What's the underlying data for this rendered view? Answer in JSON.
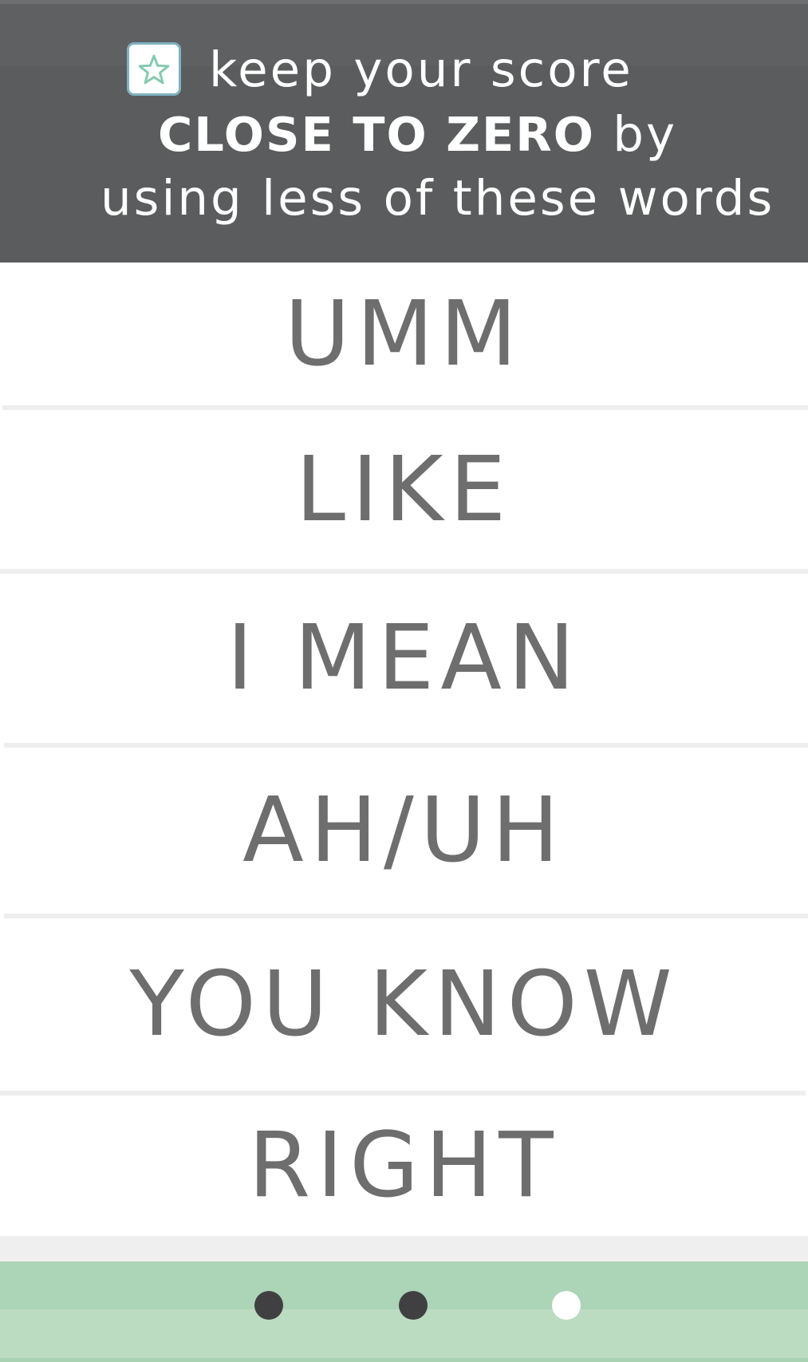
{
  "header": {
    "line1": "keep your score",
    "line2_bold": "CLOSE TO ZERO",
    "line2_rest": " by",
    "line3": "using less of these words",
    "badge_icon": "star-icon"
  },
  "words": [
    "UMM",
    "LIKE",
    "I MEAN",
    "AH/UH",
    "YOU KNOW",
    "RIGHT"
  ],
  "pager": {
    "page_count": 3,
    "current_page": 3
  },
  "colors": {
    "header_bg": "#5b5c5e",
    "word_text": "#6e6e6e",
    "footer_bg": "#bcdcc2",
    "badge_border": "#7fb2c0",
    "star_stroke": "#86cbb0"
  }
}
